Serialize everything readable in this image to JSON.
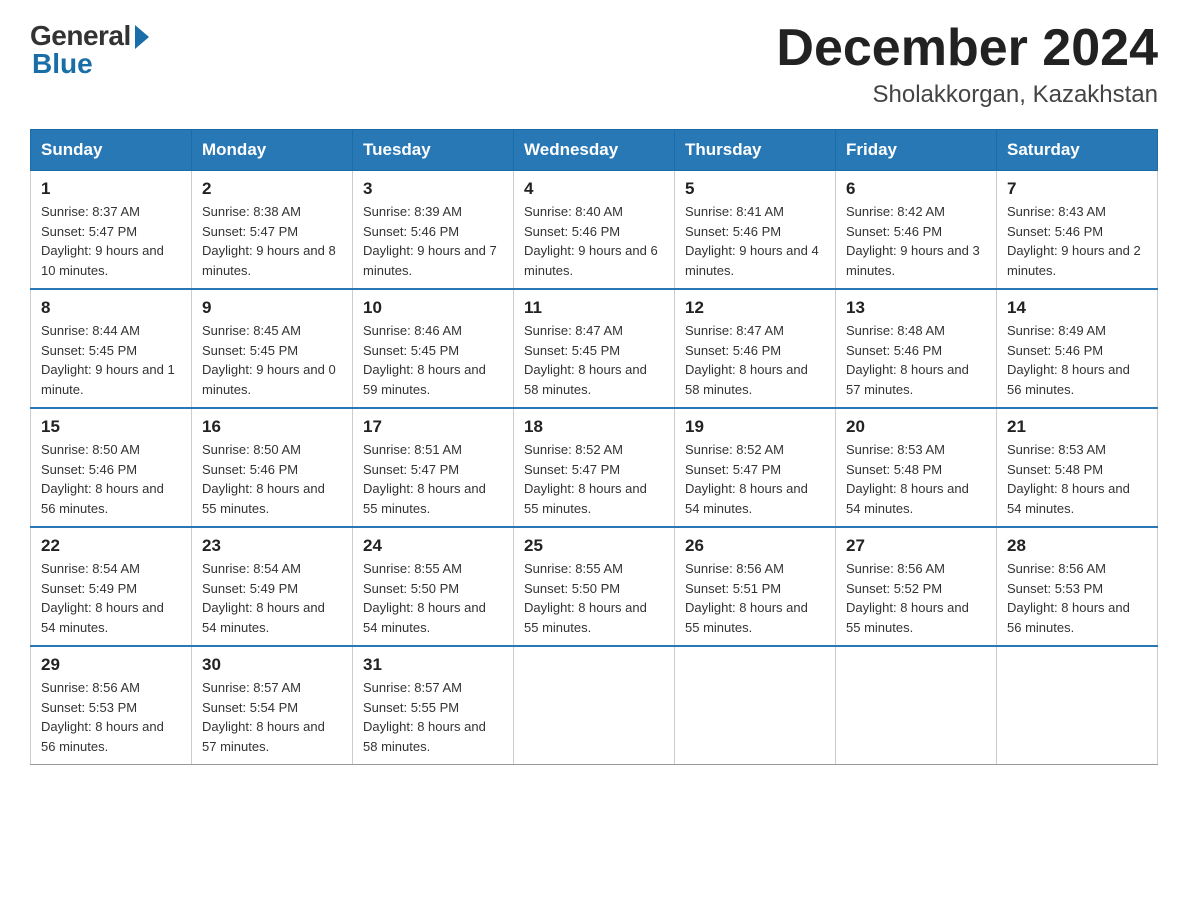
{
  "header": {
    "logo_general": "General",
    "logo_blue": "Blue",
    "month_title": "December 2024",
    "location": "Sholakkorgan, Kazakhstan"
  },
  "days_of_week": [
    "Sunday",
    "Monday",
    "Tuesday",
    "Wednesday",
    "Thursday",
    "Friday",
    "Saturday"
  ],
  "weeks": [
    [
      {
        "day": "1",
        "sunrise": "8:37 AM",
        "sunset": "5:47 PM",
        "daylight": "9 hours and 10 minutes."
      },
      {
        "day": "2",
        "sunrise": "8:38 AM",
        "sunset": "5:47 PM",
        "daylight": "9 hours and 8 minutes."
      },
      {
        "day": "3",
        "sunrise": "8:39 AM",
        "sunset": "5:46 PM",
        "daylight": "9 hours and 7 minutes."
      },
      {
        "day": "4",
        "sunrise": "8:40 AM",
        "sunset": "5:46 PM",
        "daylight": "9 hours and 6 minutes."
      },
      {
        "day": "5",
        "sunrise": "8:41 AM",
        "sunset": "5:46 PM",
        "daylight": "9 hours and 4 minutes."
      },
      {
        "day": "6",
        "sunrise": "8:42 AM",
        "sunset": "5:46 PM",
        "daylight": "9 hours and 3 minutes."
      },
      {
        "day": "7",
        "sunrise": "8:43 AM",
        "sunset": "5:46 PM",
        "daylight": "9 hours and 2 minutes."
      }
    ],
    [
      {
        "day": "8",
        "sunrise": "8:44 AM",
        "sunset": "5:45 PM",
        "daylight": "9 hours and 1 minute."
      },
      {
        "day": "9",
        "sunrise": "8:45 AM",
        "sunset": "5:45 PM",
        "daylight": "9 hours and 0 minutes."
      },
      {
        "day": "10",
        "sunrise": "8:46 AM",
        "sunset": "5:45 PM",
        "daylight": "8 hours and 59 minutes."
      },
      {
        "day": "11",
        "sunrise": "8:47 AM",
        "sunset": "5:45 PM",
        "daylight": "8 hours and 58 minutes."
      },
      {
        "day": "12",
        "sunrise": "8:47 AM",
        "sunset": "5:46 PM",
        "daylight": "8 hours and 58 minutes."
      },
      {
        "day": "13",
        "sunrise": "8:48 AM",
        "sunset": "5:46 PM",
        "daylight": "8 hours and 57 minutes."
      },
      {
        "day": "14",
        "sunrise": "8:49 AM",
        "sunset": "5:46 PM",
        "daylight": "8 hours and 56 minutes."
      }
    ],
    [
      {
        "day": "15",
        "sunrise": "8:50 AM",
        "sunset": "5:46 PM",
        "daylight": "8 hours and 56 minutes."
      },
      {
        "day": "16",
        "sunrise": "8:50 AM",
        "sunset": "5:46 PM",
        "daylight": "8 hours and 55 minutes."
      },
      {
        "day": "17",
        "sunrise": "8:51 AM",
        "sunset": "5:47 PM",
        "daylight": "8 hours and 55 minutes."
      },
      {
        "day": "18",
        "sunrise": "8:52 AM",
        "sunset": "5:47 PM",
        "daylight": "8 hours and 55 minutes."
      },
      {
        "day": "19",
        "sunrise": "8:52 AM",
        "sunset": "5:47 PM",
        "daylight": "8 hours and 54 minutes."
      },
      {
        "day": "20",
        "sunrise": "8:53 AM",
        "sunset": "5:48 PM",
        "daylight": "8 hours and 54 minutes."
      },
      {
        "day": "21",
        "sunrise": "8:53 AM",
        "sunset": "5:48 PM",
        "daylight": "8 hours and 54 minutes."
      }
    ],
    [
      {
        "day": "22",
        "sunrise": "8:54 AM",
        "sunset": "5:49 PM",
        "daylight": "8 hours and 54 minutes."
      },
      {
        "day": "23",
        "sunrise": "8:54 AM",
        "sunset": "5:49 PM",
        "daylight": "8 hours and 54 minutes."
      },
      {
        "day": "24",
        "sunrise": "8:55 AM",
        "sunset": "5:50 PM",
        "daylight": "8 hours and 54 minutes."
      },
      {
        "day": "25",
        "sunrise": "8:55 AM",
        "sunset": "5:50 PM",
        "daylight": "8 hours and 55 minutes."
      },
      {
        "day": "26",
        "sunrise": "8:56 AM",
        "sunset": "5:51 PM",
        "daylight": "8 hours and 55 minutes."
      },
      {
        "day": "27",
        "sunrise": "8:56 AM",
        "sunset": "5:52 PM",
        "daylight": "8 hours and 55 minutes."
      },
      {
        "day": "28",
        "sunrise": "8:56 AM",
        "sunset": "5:53 PM",
        "daylight": "8 hours and 56 minutes."
      }
    ],
    [
      {
        "day": "29",
        "sunrise": "8:56 AM",
        "sunset": "5:53 PM",
        "daylight": "8 hours and 56 minutes."
      },
      {
        "day": "30",
        "sunrise": "8:57 AM",
        "sunset": "5:54 PM",
        "daylight": "8 hours and 57 minutes."
      },
      {
        "day": "31",
        "sunrise": "8:57 AM",
        "sunset": "5:55 PM",
        "daylight": "8 hours and 58 minutes."
      },
      null,
      null,
      null,
      null
    ]
  ]
}
